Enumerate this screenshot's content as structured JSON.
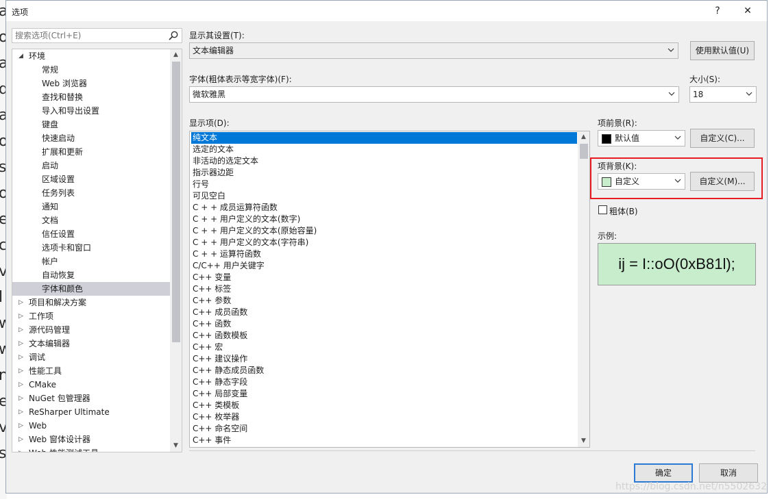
{
  "window": {
    "title": "选项",
    "help_label": "?",
    "close_label": "✕"
  },
  "search": {
    "placeholder": "搜索选项(Ctrl+E)"
  },
  "tree": {
    "items": [
      {
        "label": "环境",
        "level": 0,
        "expanded": true
      },
      {
        "label": "常规",
        "level": 1
      },
      {
        "label": "Web 浏览器",
        "level": 1
      },
      {
        "label": "查找和替换",
        "level": 1
      },
      {
        "label": "导入和导出设置",
        "level": 1
      },
      {
        "label": "键盘",
        "level": 1
      },
      {
        "label": "快速启动",
        "level": 1
      },
      {
        "label": "扩展和更新",
        "level": 1
      },
      {
        "label": "启动",
        "level": 1
      },
      {
        "label": "区域设置",
        "level": 1
      },
      {
        "label": "任务列表",
        "level": 1
      },
      {
        "label": "通知",
        "level": 1
      },
      {
        "label": "文档",
        "level": 1
      },
      {
        "label": "信任设置",
        "level": 1
      },
      {
        "label": "选项卡和窗口",
        "level": 1
      },
      {
        "label": "帐户",
        "level": 1
      },
      {
        "label": "自动恢复",
        "level": 1
      },
      {
        "label": "字体和颜色",
        "level": 1,
        "selected": true
      },
      {
        "label": "项目和解决方案",
        "level": 0
      },
      {
        "label": "工作项",
        "level": 0
      },
      {
        "label": "源代码管理",
        "level": 0
      },
      {
        "label": "文本编辑器",
        "level": 0
      },
      {
        "label": "调试",
        "level": 0
      },
      {
        "label": "性能工具",
        "level": 0
      },
      {
        "label": "CMake",
        "level": 0
      },
      {
        "label": "NuGet 包管理器",
        "level": 0
      },
      {
        "label": "ReSharper Ultimate",
        "level": 0
      },
      {
        "label": "Web",
        "level": 0
      },
      {
        "label": "Web 窗体设计器",
        "level": 0
      },
      {
        "label": "Web 性能测试工具",
        "level": 0
      }
    ]
  },
  "show_settings": {
    "label": "显示其设置(T):",
    "value": "文本编辑器",
    "use_default_label": "使用默认值(U)"
  },
  "font": {
    "label": "字体(粗体表示等宽字体)(F):",
    "value": "微软雅黑"
  },
  "size": {
    "label": "大小(S):",
    "value": "18"
  },
  "display_items": {
    "label": "显示项(D):",
    "items": [
      "纯文本",
      "选定的文本",
      "非活动的选定文本",
      "指示器边距",
      "行号",
      "可见空白",
      "C + + 成员运算符函数",
      "C + + 用户定义的文本(数字)",
      "C + + 用户定义的文本(原始容量)",
      "C + + 用户定义的文本(字符串)",
      "C + + 运算符函数",
      "C/C++ 用户关键字",
      "C++ 变量",
      "C++ 标签",
      "C++ 参数",
      "C++ 成员函数",
      "C++ 函数",
      "C++ 函数模板",
      "C++ 宏",
      "C++ 建议操作",
      "C++ 静态成员函数",
      "C++ 静态字段",
      "C++ 局部变量",
      "C++ 类模板",
      "C++ 枚举器",
      "C++ 命名空间",
      "C++ 事件"
    ],
    "selected_index": 0
  },
  "foreground": {
    "label": "项前景(R):",
    "value": "默认值",
    "color": "#000000",
    "custom_label": "自定义(C)..."
  },
  "background": {
    "label": "项背景(K):",
    "value": "自定义",
    "color": "#c7edcc",
    "custom_label": "自定义(M)..."
  },
  "bold": {
    "label": "粗体(B)",
    "checked": false
  },
  "sample": {
    "label": "示例:",
    "text": "ij = I::oO(0xB81l);"
  },
  "footer": {
    "ok_label": "确定",
    "cancel_label": "取消"
  },
  "watermark": "https://blog.csdn.net/n5502632",
  "colors": {
    "selection": "#0078d7",
    "highlight_box": "#e81b23",
    "primary_border": "#2a7ad5"
  },
  "background_editor_chars": [
    "a",
    "o",
    "a",
    "d",
    "a",
    "o",
    "s",
    "o",
    "e",
    "c",
    "v",
    "l",
    "w",
    "w",
    "n",
    "e",
    "v",
    "s"
  ]
}
